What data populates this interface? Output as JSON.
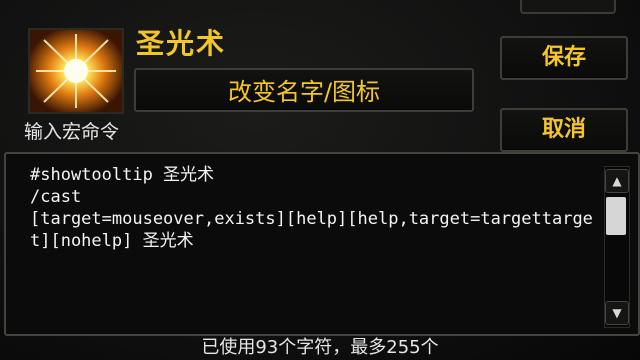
{
  "macro": {
    "name": "圣光术",
    "icon": "holy-light-icon"
  },
  "buttons": {
    "change_name_icon": "改变名字/图标",
    "save": "保存",
    "cancel": "取消"
  },
  "editor": {
    "label": "输入宏命令",
    "text": "#showtooltip 圣光术\n/cast\n[target=mouseover,exists][help][help,target=targettarget][nohelp] 圣光术"
  },
  "status": {
    "char_count": "已使用93个字符，最多255个"
  },
  "colors": {
    "accent": "#f3c72a",
    "text": "#f4f4f4",
    "background": "#0d0d0c"
  }
}
